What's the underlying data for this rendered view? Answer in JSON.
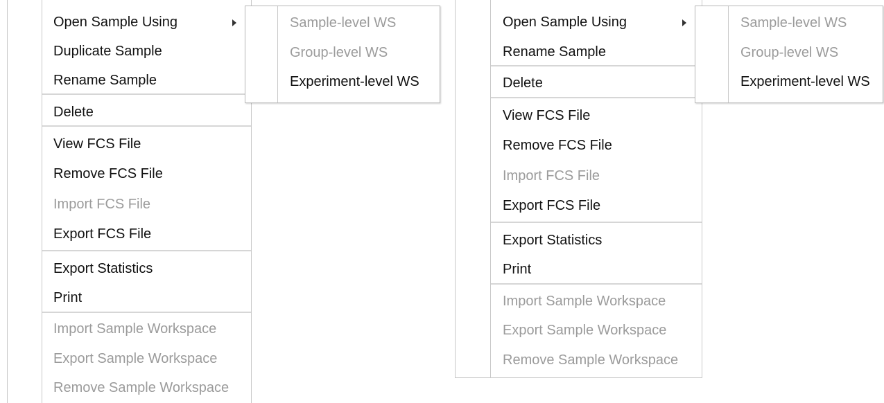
{
  "left_menu": {
    "items": [
      {
        "label": "Open Sample Using",
        "enabled": true,
        "has_submenu": true
      },
      {
        "label": "Duplicate Sample",
        "enabled": true
      },
      {
        "label": "Rename Sample",
        "enabled": true
      },
      {
        "label": "Delete",
        "enabled": true
      },
      {
        "label": "View FCS File",
        "enabled": true
      },
      {
        "label": "Remove FCS File",
        "enabled": true
      },
      {
        "label": "Import FCS File",
        "enabled": false
      },
      {
        "label": "Export FCS File",
        "enabled": true
      },
      {
        "label": "Export Statistics",
        "enabled": true
      },
      {
        "label": "Print",
        "enabled": true
      },
      {
        "label": "Import Sample Workspace",
        "enabled": false
      },
      {
        "label": "Export Sample Workspace",
        "enabled": false
      },
      {
        "label": "Remove Sample Workspace",
        "enabled": false
      }
    ]
  },
  "left_submenu": {
    "items": [
      {
        "label": "Sample-level WS",
        "enabled": false
      },
      {
        "label": "Group-level WS",
        "enabled": false
      },
      {
        "label": "Experiment-level WS",
        "enabled": true
      }
    ]
  },
  "right_menu": {
    "items": [
      {
        "label": "Open Sample Using",
        "enabled": true,
        "has_submenu": true
      },
      {
        "label": "Rename Sample",
        "enabled": true
      },
      {
        "label": "Delete",
        "enabled": true
      },
      {
        "label": "View FCS File",
        "enabled": true
      },
      {
        "label": "Remove FCS File",
        "enabled": true
      },
      {
        "label": "Import FCS File",
        "enabled": false
      },
      {
        "label": "Export FCS File",
        "enabled": true
      },
      {
        "label": "Export Statistics",
        "enabled": true
      },
      {
        "label": "Print",
        "enabled": true
      },
      {
        "label": "Import Sample Workspace",
        "enabled": false
      },
      {
        "label": "Export Sample Workspace",
        "enabled": false
      },
      {
        "label": "Remove Sample Workspace",
        "enabled": false
      }
    ]
  },
  "right_submenu": {
    "items": [
      {
        "label": "Sample-level WS",
        "enabled": false
      },
      {
        "label": "Group-level WS",
        "enabled": false
      },
      {
        "label": "Experiment-level WS",
        "enabled": true
      }
    ]
  }
}
